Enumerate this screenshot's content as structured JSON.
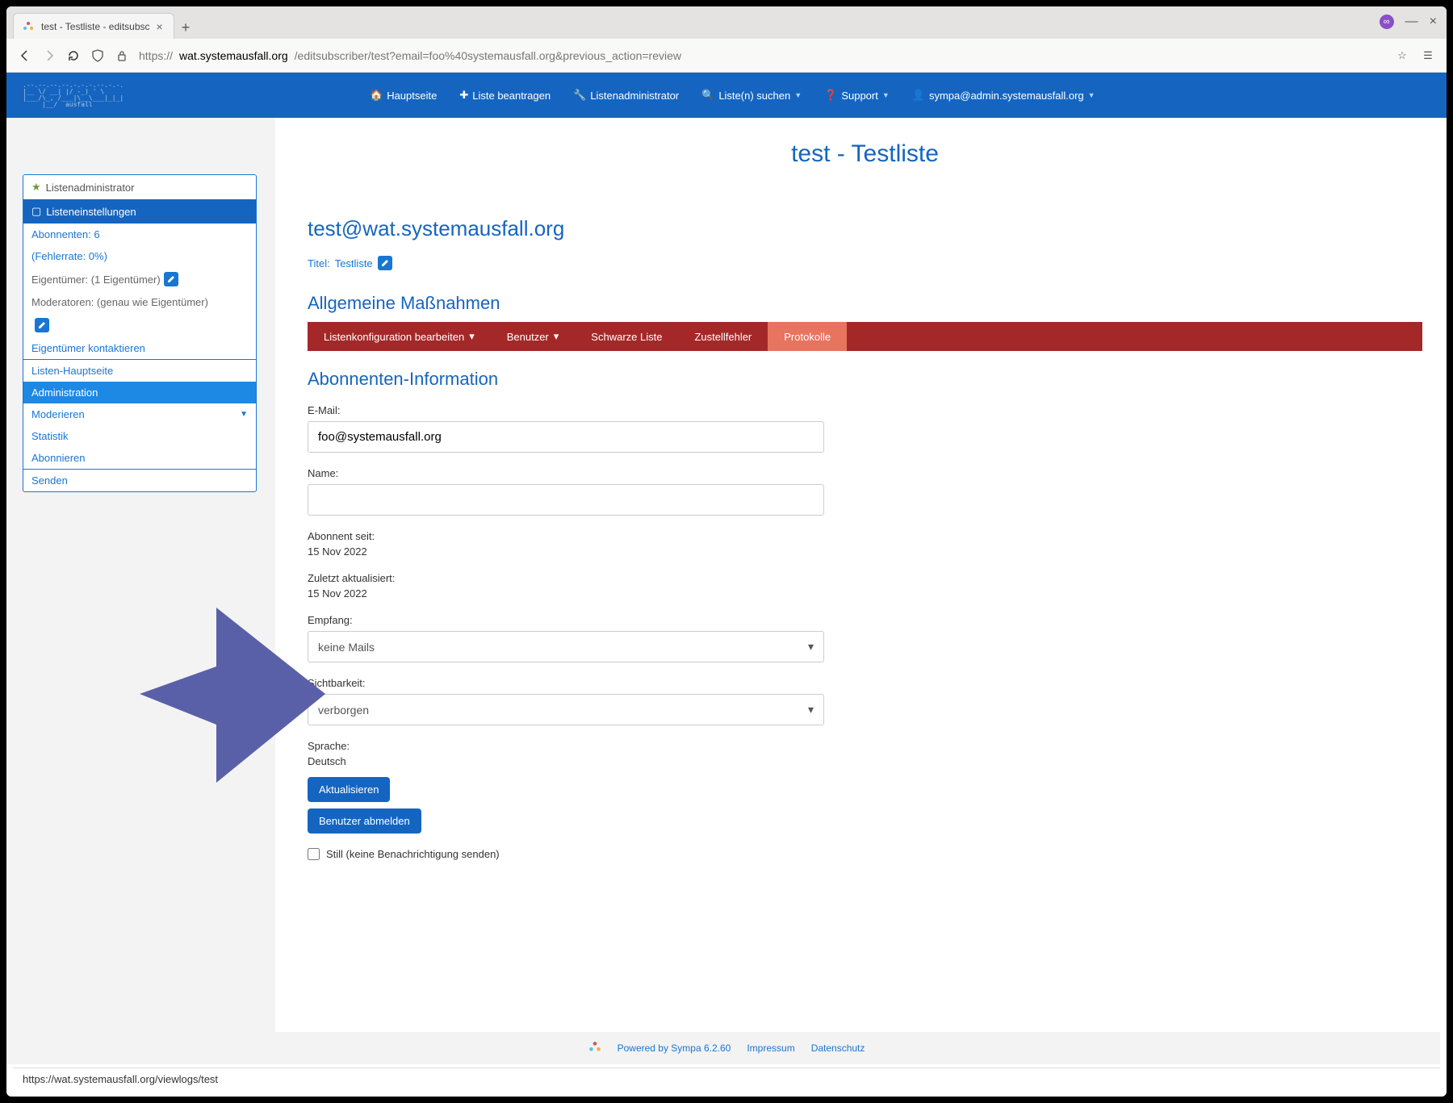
{
  "browser": {
    "tab_title": "test - Testliste - editsubsc",
    "url_host": "wat.systemausfall.org",
    "url_proto": "https://",
    "url_path": "/editsubscriber/test?email=foo%40systemausfall.org&previous_action=review",
    "status_url": "https://wat.systemausfall.org/viewlogs/test"
  },
  "nav": {
    "home": "Hauptseite",
    "request": "Liste beantragen",
    "admin": "Listenadministrator",
    "search": "Liste(n) suchen",
    "support": "Support",
    "user": "sympa@admin.systemausfall.org"
  },
  "sidebar": {
    "admin_label": "Listenadministrator",
    "settings_label": "Listeneinstellungen",
    "abonnenten": "Abonnenten: 6",
    "fehlerrate": "(Fehlerrate: 0%)",
    "eigentumer": "Eigentümer: (1 Eigentümer)",
    "moderatoren": "Moderatoren: (genau wie Eigentümer)",
    "contact_owner": "Eigentümer kontaktieren",
    "listen_haupt": "Listen-Hauptseite",
    "administration": "Administration",
    "moderieren": "Moderieren",
    "statistik": "Statistik",
    "abonnieren": "Abonnieren",
    "senden": "Senden"
  },
  "page": {
    "title": "test - Testliste",
    "list_address": "test@wat.systemausfall.org",
    "titel_label": "Titel:",
    "titel_value": "Testliste",
    "general_h": "Allgemeine Maßnahmen",
    "tabs": {
      "config": "Listenkonfiguration bearbeiten",
      "users": "Benutzer",
      "blacklist": "Schwarze Liste",
      "bounces": "Zustellfehler",
      "logs": "Protokolle"
    },
    "sub_h": "Abonnenten-Information",
    "email_label": "E-Mail:",
    "email_value": "foo@systemausfall.org",
    "name_label": "Name:",
    "name_value": "",
    "since_label": "Abonnent seit:",
    "since_value": "15 Nov 2022",
    "updated_label": "Zuletzt aktualisiert:",
    "updated_value": "15 Nov 2022",
    "reception_label": "Empfang:",
    "reception_value": "keine Mails",
    "visibility_label": "Sichtbarkeit:",
    "visibility_value": "verborgen",
    "lang_label": "Sprache:",
    "lang_value": "Deutsch",
    "btn_update": "Aktualisieren",
    "btn_remove": "Benutzer abmelden",
    "quiet_label": "Still (keine Benachrichtigung senden)"
  },
  "footer": {
    "powered": "Powered by Sympa 6.2.60",
    "impressum": "Impressum",
    "datenschutz": "Datenschutz"
  }
}
